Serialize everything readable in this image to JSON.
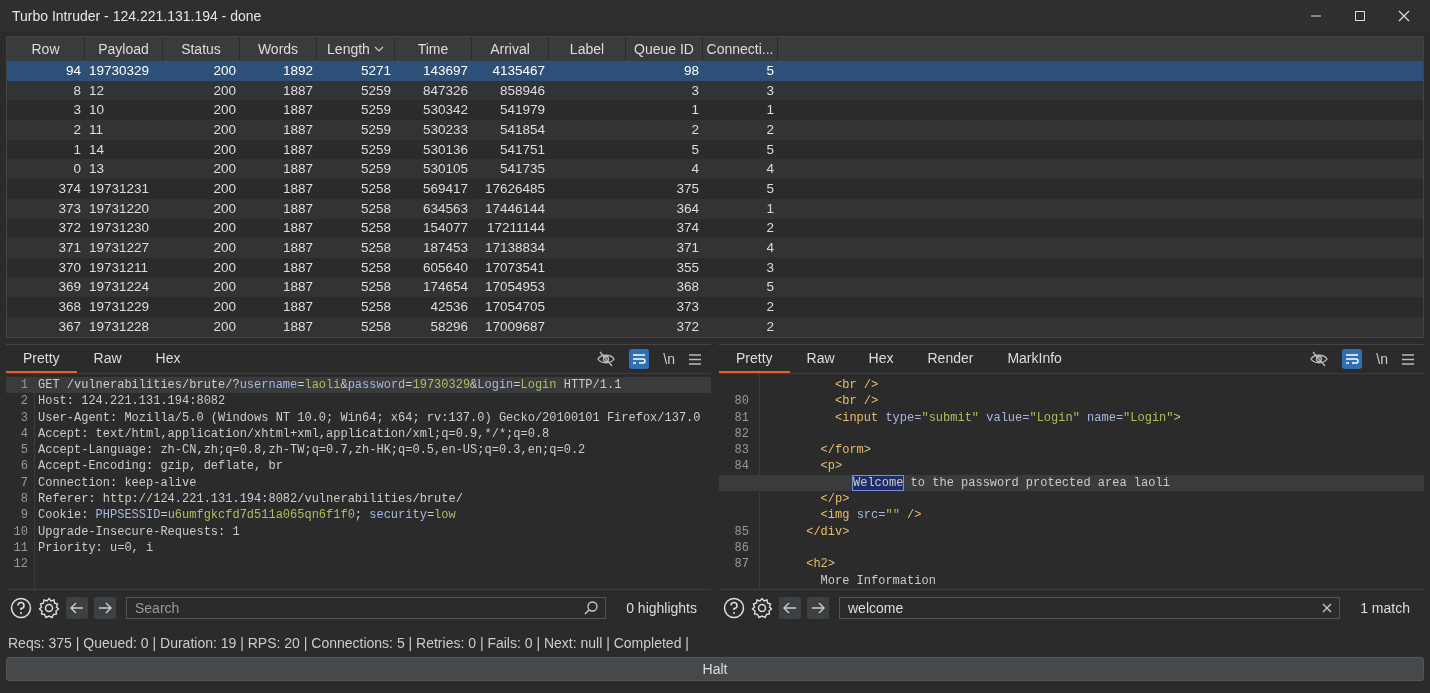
{
  "window": {
    "title": "Turbo Intruder - 124.221.131.194 - done"
  },
  "table": {
    "columns": [
      {
        "label": "Row",
        "sorted": false
      },
      {
        "label": "Payload",
        "sorted": false
      },
      {
        "label": "Status",
        "sorted": false
      },
      {
        "label": "Words",
        "sorted": false
      },
      {
        "label": "Length",
        "sorted": true
      },
      {
        "label": "Time",
        "sorted": false
      },
      {
        "label": "Arrival",
        "sorted": false
      },
      {
        "label": "Label",
        "sorted": false
      },
      {
        "label": "Queue ID",
        "sorted": false
      },
      {
        "label": "Connecti...",
        "sorted": false
      }
    ],
    "rows": [
      {
        "selected": true,
        "cells": [
          "94",
          "19730329",
          "200",
          "1892",
          "5271",
          "143697",
          "4135467",
          null,
          "98",
          "5"
        ]
      },
      {
        "selected": false,
        "cells": [
          "8",
          "12",
          "200",
          "1887",
          "5259",
          "847326",
          "858946",
          null,
          "3",
          "3"
        ]
      },
      {
        "selected": false,
        "cells": [
          "3",
          "10",
          "200",
          "1887",
          "5259",
          "530342",
          "541979",
          null,
          "1",
          "1"
        ]
      },
      {
        "selected": false,
        "cells": [
          "2",
          "11",
          "200",
          "1887",
          "5259",
          "530233",
          "541854",
          null,
          "2",
          "2"
        ]
      },
      {
        "selected": false,
        "cells": [
          "1",
          "14",
          "200",
          "1887",
          "5259",
          "530136",
          "541751",
          null,
          "5",
          "5"
        ]
      },
      {
        "selected": false,
        "cells": [
          "0",
          "13",
          "200",
          "1887",
          "5259",
          "530105",
          "541735",
          null,
          "4",
          "4"
        ]
      },
      {
        "selected": false,
        "cells": [
          "374",
          "19731231",
          "200",
          "1887",
          "5258",
          "569417",
          "17626485",
          null,
          "375",
          "5"
        ]
      },
      {
        "selected": false,
        "cells": [
          "373",
          "19731220",
          "200",
          "1887",
          "5258",
          "634563",
          "17446144",
          null,
          "364",
          "1"
        ]
      },
      {
        "selected": false,
        "cells": [
          "372",
          "19731230",
          "200",
          "1887",
          "5258",
          "154077",
          "17211144",
          null,
          "374",
          "2"
        ]
      },
      {
        "selected": false,
        "cells": [
          "371",
          "19731227",
          "200",
          "1887",
          "5258",
          "187453",
          "17138834",
          null,
          "371",
          "4"
        ]
      },
      {
        "selected": false,
        "cells": [
          "370",
          "19731211",
          "200",
          "1887",
          "5258",
          "605640",
          "17073541",
          null,
          "355",
          "3"
        ]
      },
      {
        "selected": false,
        "cells": [
          "369",
          "19731224",
          "200",
          "1887",
          "5258",
          "174654",
          "17054953",
          null,
          "368",
          "5"
        ]
      },
      {
        "selected": false,
        "cells": [
          "368",
          "19731229",
          "200",
          "1887",
          "5258",
          "42536",
          "17054705",
          null,
          "373",
          "2"
        ]
      },
      {
        "selected": false,
        "cells": [
          "367",
          "19731228",
          "200",
          "1887",
          "5258",
          "58296",
          "17009687",
          null,
          "372",
          "2"
        ]
      }
    ]
  },
  "panes": [
    {
      "tabs": [
        {
          "label": "Pretty",
          "selected": true
        },
        {
          "label": "Raw",
          "selected": false
        },
        {
          "label": "Hex",
          "selected": false
        }
      ],
      "wrap_on": true,
      "newline_label": "\\n",
      "lines": [
        {
          "number": "1",
          "current": true,
          "segments": [
            {
              "kind": "plain",
              "text": "GET /vulnerabilities/brute/?"
            },
            {
              "kind": "key",
              "text": "username"
            },
            {
              "kind": "plain",
              "text": "="
            },
            {
              "kind": "value",
              "text": "laoli"
            },
            {
              "kind": "plain",
              "text": "&"
            },
            {
              "kind": "key",
              "text": "password"
            },
            {
              "kind": "plain",
              "text": "="
            },
            {
              "kind": "value",
              "text": "19730329"
            },
            {
              "kind": "plain",
              "text": "&"
            },
            {
              "kind": "key",
              "text": "Login"
            },
            {
              "kind": "plain",
              "text": "="
            },
            {
              "kind": "value",
              "text": "Login"
            },
            {
              "kind": "plain",
              "text": " HTTP/1.1"
            }
          ]
        },
        {
          "number": "2",
          "current": false,
          "segments": [
            {
              "kind": "plain",
              "text": "Host: 124.221.131.194:8082"
            }
          ]
        },
        {
          "number": "3",
          "current": false,
          "segments": [
            {
              "kind": "plain",
              "text": "User-Agent: Mozilla/5.0 (Windows NT 10.0; Win64; x64; rv:137.0) Gecko/20100101 Firefox/137.0"
            }
          ]
        },
        {
          "number": "4",
          "current": false,
          "segments": [
            {
              "kind": "plain",
              "text": "Accept: text/html,application/xhtml+xml,application/xml;q=0.9,*/*;q=0.8"
            }
          ]
        },
        {
          "number": "5",
          "current": false,
          "segments": [
            {
              "kind": "plain",
              "text": "Accept-Language: zh-CN,zh;q=0.8,zh-TW;q=0.7,zh-HK;q=0.5,en-US;q=0.3,en;q=0.2"
            }
          ]
        },
        {
          "number": "6",
          "current": false,
          "segments": [
            {
              "kind": "plain",
              "text": "Accept-Encoding: gzip, deflate, br"
            }
          ]
        },
        {
          "number": "7",
          "current": false,
          "segments": [
            {
              "kind": "plain",
              "text": "Connection: keep-alive"
            }
          ]
        },
        {
          "number": "8",
          "current": false,
          "segments": [
            {
              "kind": "plain",
              "text": "Referer: http://124.221.131.194:8082/vulnerabilities/brute/"
            }
          ]
        },
        {
          "number": "9",
          "current": false,
          "segments": [
            {
              "kind": "plain",
              "text": "Cookie: "
            },
            {
              "kind": "key",
              "text": "PHPSESSID"
            },
            {
              "kind": "plain",
              "text": "="
            },
            {
              "kind": "value",
              "text": "u6umfgkcfd7d511a065qn6f1f0"
            },
            {
              "kind": "plain",
              "text": "; "
            },
            {
              "kind": "key",
              "text": "security"
            },
            {
              "kind": "plain",
              "text": "="
            },
            {
              "kind": "value",
              "text": "low"
            }
          ]
        },
        {
          "number": "10",
          "current": false,
          "segments": [
            {
              "kind": "plain",
              "text": "Upgrade-Insecure-Requests: 1"
            }
          ]
        },
        {
          "number": "11",
          "current": false,
          "segments": [
            {
              "kind": "plain",
              "text": "Priority: u=0, i"
            }
          ]
        },
        {
          "number": "12",
          "current": false
        }
      ],
      "search": {
        "placeholder": "Search",
        "result": "0 highlights"
      }
    },
    {
      "tabs": [
        {
          "label": "Pretty",
          "selected": true
        },
        {
          "label": "Raw",
          "selected": false
        },
        {
          "label": "Hex",
          "selected": false
        },
        {
          "label": "Render",
          "selected": false
        },
        {
          "label": "MarkInfo",
          "selected": false
        }
      ],
      "wrap_on": true,
      "newline_label": "\\n",
      "lines": [
        {
          "current": false,
          "segments": [
            {
              "kind": "tag",
              "text": "          <br />"
            }
          ]
        },
        {
          "number": "80",
          "current": false,
          "segments": [
            {
              "kind": "tag",
              "text": "          <br />"
            }
          ]
        },
        {
          "number": "81",
          "current": false,
          "segments": [
            {
              "kind": "tag",
              "text": "          <input "
            },
            {
              "kind": "key",
              "text": "type="
            },
            {
              "kind": "value",
              "text": "\"submit\" "
            },
            {
              "kind": "key",
              "text": "value="
            },
            {
              "kind": "value",
              "text": "\"Login\" "
            },
            {
              "kind": "key",
              "text": "name="
            },
            {
              "kind": "value",
              "text": "\"Login\""
            },
            {
              "kind": "tag",
              "text": ">"
            }
          ]
        },
        {
          "number": "82",
          "current": false
        },
        {
          "number": "83",
          "current": false,
          "segments": [
            {
              "kind": "tag",
              "text": "        </form>"
            }
          ]
        },
        {
          "number": "84",
          "current": false,
          "segments": [
            {
              "kind": "tag",
              "text": "        <p>"
            }
          ]
        },
        {
          "current": true,
          "segments": [
            {
              "kind": "match",
              "text": "Welcome"
            },
            {
              "kind": "plain",
              "text": " to the password protected area laoli"
            }
          ]
        },
        {
          "current": false,
          "segments": [
            {
              "kind": "tag",
              "text": "        </p>"
            }
          ]
        },
        {
          "current": false,
          "segments": [
            {
              "kind": "tag",
              "text": "        <img "
            },
            {
              "kind": "key",
              "text": "src="
            },
            {
              "kind": "value",
              "text": "\"\" "
            },
            {
              "kind": "tag",
              "text": "/>"
            }
          ]
        },
        {
          "number": "85",
          "current": false,
          "segments": [
            {
              "kind": "tag",
              "text": "      </div>"
            }
          ]
        },
        {
          "number": "86",
          "current": false
        },
        {
          "number": "87",
          "current": false,
          "segments": [
            {
              "kind": "tag",
              "text": "      <h2>"
            }
          ]
        },
        {
          "current": false,
          "segments": [
            {
              "kind": "plain",
              "text": "        More Information"
            }
          ]
        }
      ],
      "search": {
        "value": "welcome",
        "result": "1 match"
      }
    }
  ],
  "status_bar": "Reqs: 375 | Queued: 0 | Duration: 19 | RPS: 20 | Connections: 5 | Retries: 0 | Fails: 0 | Next: null | Completed |",
  "halt_button": "Halt"
}
